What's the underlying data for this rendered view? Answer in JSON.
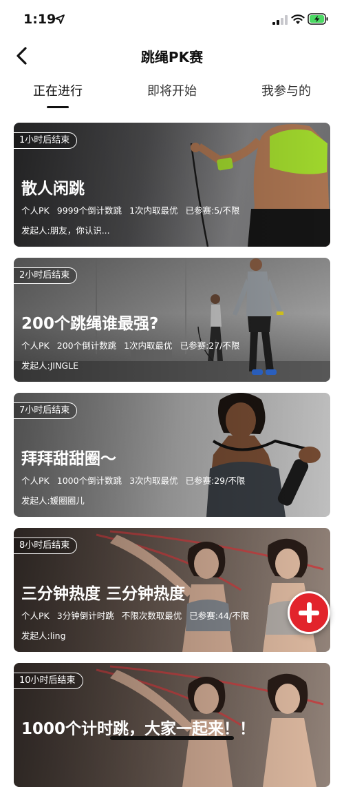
{
  "status_bar": {
    "time": "1:19",
    "icons": [
      "location-arrow-icon",
      "signal-icon",
      "wifi-icon",
      "battery-charging-icon"
    ],
    "battery_color": "#4cd964"
  },
  "nav": {
    "title": "跳绳PK赛",
    "back_icon": "chevron-left-icon"
  },
  "tabs": [
    {
      "label": "正在进行",
      "active": true
    },
    {
      "label": "即将开始",
      "active": false
    },
    {
      "label": "我参与的",
      "active": false
    }
  ],
  "cards": [
    {
      "badge": "1小时后结束",
      "title": "散人闲跳",
      "mode": "个人PK",
      "count": "9999个倒计数跳",
      "rule": "1次内取最优",
      "joined": "已参赛:5/不限",
      "creator": "发起人:朋友，你认识..."
    },
    {
      "badge": "2小时后结束",
      "title": "200个跳绳谁最强?",
      "mode": "个人PK",
      "count": "200个倒计数跳",
      "rule": "1次内取最优",
      "joined": "已参赛:27/不限",
      "creator": "发起人:JINGLE"
    },
    {
      "badge": "7小时后结束",
      "title": "拜拜甜甜圈～",
      "mode": "个人PK",
      "count": "1000个倒计数跳",
      "rule": "3次内取最优",
      "joined": "已参赛:29/不限",
      "creator": "发起人:媛圈圈儿"
    },
    {
      "badge": "8小时后结束",
      "title": "三分钟热度 三分钟热度",
      "mode": "个人PK",
      "count": "3分钟倒计时跳",
      "rule": "不限次数取最优",
      "joined": "已参赛:44/不限",
      "creator": "发起人:ling"
    },
    {
      "badge": "10小时后结束",
      "title": "1000个计时跳，大家一起来！！",
      "mode": "",
      "count": "",
      "rule": "",
      "joined": "",
      "creator": ""
    }
  ],
  "fab": {
    "icon": "plus-icon",
    "color": "#e2242c"
  }
}
